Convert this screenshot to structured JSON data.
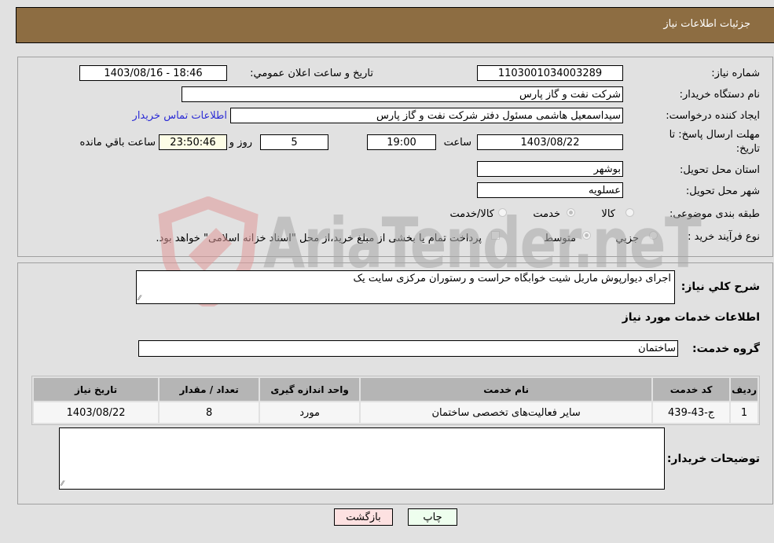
{
  "header": {
    "title": "جزئیات اطلاعات نیاز"
  },
  "form": {
    "need_number": {
      "label": "شماره نیاز:",
      "value": "1103001034003289"
    },
    "announce_datetime": {
      "label": "تاریخ و ساعت اعلان عمومي:",
      "value": "1403/08/16 - 18:46"
    },
    "buyer_org": {
      "label": "نام دستگاه خریدار:",
      "value": "شرکت نفت و گاز پارس"
    },
    "requester": {
      "label": "ایجاد کننده درخواست:",
      "value": "سیداسمعیل هاشمی مسئول دفتر شرکت نفت و گاز پارس"
    },
    "buyer_contact_link": "اطلاعات تماس خریدار",
    "deadline": {
      "label_line1": "مهلت ارسال پاسخ: تا",
      "label_line2": "تاریخ:",
      "date": "1403/08/22",
      "time_label": "ساعت",
      "time": "19:00",
      "days": "5",
      "days_label": "روز و",
      "remaining": "23:50:46",
      "remaining_label": "ساعت باقي مانده"
    },
    "province": {
      "label": "استان محل تحویل:",
      "value": "بوشهر"
    },
    "city": {
      "label": "شهر محل تحویل:",
      "value": "عسلویه"
    },
    "category": {
      "label": "طبقه بندی موضوعی:",
      "options": [
        "کالا",
        "خدمت",
        "کالا/خدمت"
      ],
      "selected": "خدمت"
    },
    "purchase_type": {
      "label": "نوع فرآیند خرید :",
      "options": [
        "جزیي",
        "متوسط"
      ],
      "selected": "متوسط",
      "treasury_note": "پرداخت تمام یا بخشی از مبلغ خرید،از محل \"اسناد خزانه اسلامی\" خواهد بود."
    }
  },
  "details": {
    "description_label": "شرح کلي نیاز:",
    "description": "اجرای دیوارپوش ماربل شیت خوابگاه حراست و رستوران مرکزی سایت یک",
    "services_heading": "اطلاعات خدمات مورد نیاز",
    "service_group_label": "گروه خدمت:",
    "service_group": "ساختمان",
    "table": {
      "headers": [
        "ردیف",
        "کد خدمت",
        "نام خدمت",
        "واحد اندازه گیری",
        "تعداد / مقدار",
        "تاریخ نیاز"
      ],
      "rows": [
        [
          "1",
          "ج-43-439",
          "سایر فعالیت‌های تخصصی ساختمان",
          "مورد",
          "8",
          "1403/08/22"
        ]
      ]
    },
    "buyer_notes_label": "توضیحات خریدار:",
    "buyer_notes": ""
  },
  "buttons": {
    "print": "چاپ",
    "back": "بازگشت"
  },
  "watermark": {
    "text": "AriaTender.neT"
  },
  "colors": {
    "header_bg": "#8d6d42",
    "link": "#2b2bd5",
    "print_bg": "#eefeee",
    "back_bg": "#fde1e1"
  }
}
